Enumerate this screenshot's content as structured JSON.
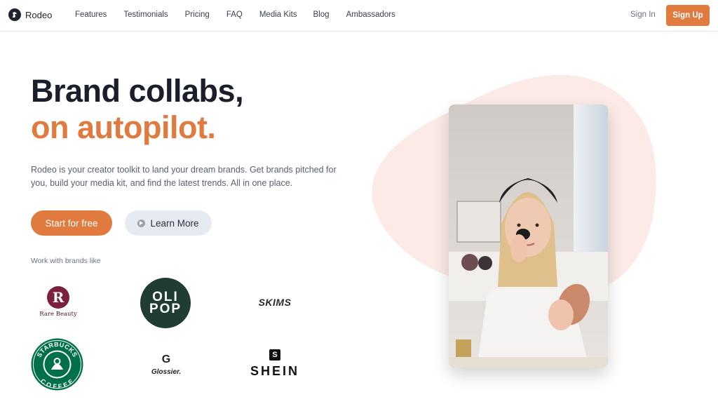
{
  "brand": {
    "name": "Rodeo",
    "logo_icon": "horse-icon"
  },
  "nav": {
    "links": [
      "Features",
      "Testimonials",
      "Pricing",
      "FAQ",
      "Media Kits",
      "Blog",
      "Ambassadors"
    ],
    "sign_in": "Sign In",
    "sign_up": "Sign Up"
  },
  "hero": {
    "headline_line1": "Brand collabs,",
    "headline_line2": "on autopilot.",
    "subtext": "Rodeo is your creator toolkit to land your dream brands. Get brands pitched for you, build your media kit, and find the latest trends. All in one place.",
    "cta_primary": "Start for free",
    "cta_secondary": "Learn More",
    "cta_secondary_icon": "play-icon"
  },
  "brands": {
    "label": "Work with brands like",
    "rare_beauty": {
      "letter": "R",
      "text": "Rare Beauty"
    },
    "olipop": {
      "line1": "OLI",
      "line2": "POP"
    },
    "skims": "SKIMS",
    "starbucks": {
      "top": "STARBUCKS",
      "bottom": "COFFEE"
    },
    "glossier": {
      "letter": "G",
      "text": "Glossier."
    },
    "shein": {
      "letter": "S",
      "text": "SHEIN"
    }
  },
  "colors": {
    "accent": "#e07a3e",
    "headline": "#1a1f2b",
    "blob": "#fbeae6",
    "olipop_green": "#1f3d33",
    "starbucks_green": "#00704a",
    "rare_beauty": "#7d1f3e"
  }
}
